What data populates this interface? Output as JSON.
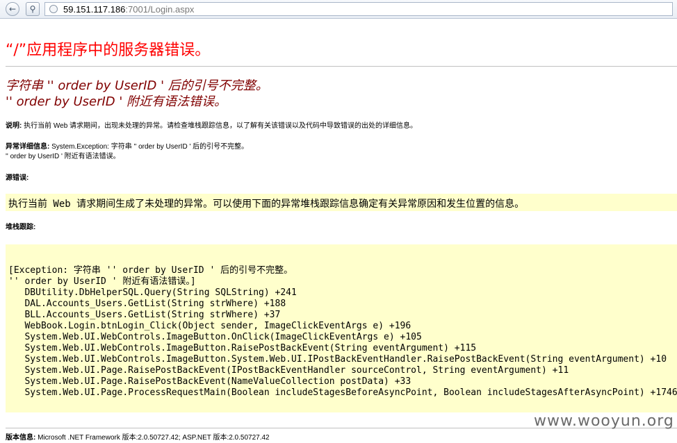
{
  "browser": {
    "url_host": "59.151.117.186",
    "url_rest": ":7001/Login.aspx"
  },
  "page": {
    "title": "“/”应用程序中的服务器错误。",
    "error_heading_line1": "字符串 '' order by UserID ' 后的引号不完整。",
    "error_heading_line2": "'' order by UserID ' 附近有语法错误。",
    "description_label": "说明:",
    "description_text": " 执行当前 Web 请求期间，出现未处理的异常。请检查堆栈跟踪信息，以了解有关该错误以及代码中导致错误的出处的详细信息。",
    "exception_label": "异常详细信息:",
    "exception_text": " System.Exception: 字符串 '' order by UserID ' 后的引号不完整。",
    "exception_text2": "'' order by UserID ' 附近有语法错误。",
    "source_label": "源错误:",
    "source_text": "执行当前 Web 请求期间生成了未处理的异常。可以使用下面的异常堆栈跟踪信息确定有关异常原因和发生位置的信息。",
    "stack_label": "堆栈跟踪:",
    "stack_lines": [
      "[Exception: 字符串 '' order by UserID ' 后的引号不完整。",
      "'' order by UserID ' 附近有语法错误。]",
      "   DBUtility.DbHelperSQL.Query(String SQLString) +241",
      "   DAL.Accounts_Users.GetList(String strWhere) +188",
      "   BLL.Accounts_Users.GetList(String strWhere) +37",
      "   WebBook.Login.btnLogin_Click(Object sender, ImageClickEventArgs e) +196",
      "   System.Web.UI.WebControls.ImageButton.OnClick(ImageClickEventArgs e) +105",
      "   System.Web.UI.WebControls.ImageButton.RaisePostBackEvent(String eventArgument) +115",
      "   System.Web.UI.WebControls.ImageButton.System.Web.UI.IPostBackEventHandler.RaisePostBackEvent(String eventArgument) +10",
      "   System.Web.UI.Page.RaisePostBackEvent(IPostBackEventHandler sourceControl, String eventArgument) +11",
      "   System.Web.UI.Page.RaisePostBackEvent(NameValueCollection postData) +33",
      "   System.Web.UI.Page.ProcessRequestMain(Boolean includeStagesBeforeAsyncPoint, Boolean includeStagesAfterAsyncPoint) +1746"
    ],
    "version_label": "版本信息:",
    "version_text": " Microsoft .NET Framework 版本:2.0.50727.42; ASP.NET 版本:2.0.50727.42"
  },
  "watermark": "www.wooyun.org",
  "colors": {
    "title": "#ff0000",
    "heading": "#800000",
    "code_bg": "#ffffcc"
  }
}
